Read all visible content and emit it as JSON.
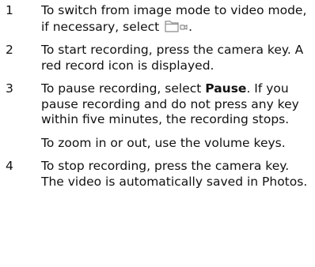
{
  "steps": [
    {
      "number": "1",
      "text_before_icon": "To switch from image mode to video mode, if necessary, select",
      "text_after_icon": ".",
      "icon": "video-mode-icon"
    },
    {
      "number": "2",
      "text": "To start recording, press the camera key. A red record icon is displayed."
    },
    {
      "number": "3",
      "text_before_bold": "To pause recording, select ",
      "bold": "Pause",
      "text_after_bold": ". If you pause recording and do not press any key within five minutes, the recording stops.",
      "extra": "To zoom in or out, use the volume keys."
    },
    {
      "number": "4",
      "text": "To stop recording, press the camera key. The video is automatically saved in Photos."
    }
  ]
}
